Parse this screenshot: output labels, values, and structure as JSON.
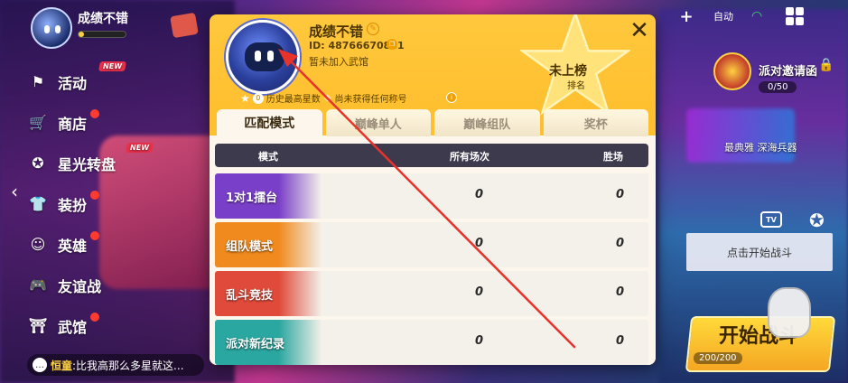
{
  "profile_top": {
    "name": "成绩不错",
    "level_progress": 0.12
  },
  "menu": {
    "items": [
      {
        "label": "活动",
        "icon": "flag-icon",
        "badge": "new"
      },
      {
        "label": "商店",
        "icon": "cart-icon",
        "badge": "dot"
      },
      {
        "label": "星光转盘",
        "icon": "star-wheel-icon",
        "badge": "new"
      },
      {
        "label": "装扮",
        "icon": "shirt-icon",
        "badge": "dot"
      },
      {
        "label": "英雄",
        "icon": "hero-icon",
        "badge": "dot"
      },
      {
        "label": "友谊战",
        "icon": "gamepad-icon",
        "badge": ""
      },
      {
        "label": "武馆",
        "icon": "guild-icon",
        "badge": "dot"
      }
    ]
  },
  "chat": {
    "name": "恒童",
    "message": ":比我高那么多星就这..."
  },
  "top_right": {
    "auto_label": "自动"
  },
  "invite": {
    "title": "派对邀请函",
    "count": "0/50"
  },
  "promo": {
    "text": "最典雅 深海兵器"
  },
  "battle": {
    "tv_label": "TV",
    "prompt": "点击开始战斗",
    "start_label": "开始战斗",
    "start_sub": "200/200"
  },
  "popup": {
    "name": "成绩不错",
    "id_text": "ID: 48766670861",
    "guild_text": "暂未加入武馆",
    "stats": {
      "best_stars": "0",
      "best_stars_label": "历史最高星数",
      "title_text": "尚未获得任何称号"
    },
    "rank": {
      "label": "未上榜",
      "sub": "排名"
    },
    "close_symbol": "✕",
    "tabs": [
      "匹配模式",
      "巅峰单人",
      "巅峰组队",
      "奖杯"
    ],
    "active_tab": 0,
    "table": {
      "headers": {
        "mode": "模式",
        "all": "所有场次",
        "win": "胜场"
      },
      "rows": [
        {
          "mode": "1对1擂台",
          "all": "0",
          "win": "0",
          "color": "#7a3fc8"
        },
        {
          "mode": "组队模式",
          "all": "0",
          "win": "0",
          "color": "#f08a1e"
        },
        {
          "mode": "乱斗竞技",
          "all": "0",
          "win": "0",
          "color": "#e04a3a"
        },
        {
          "mode": "派对新纪录",
          "all": "0",
          "win": "0",
          "color": "#2aa7a0"
        }
      ]
    }
  },
  "colors": {
    "popup_bg": "#ffc83d",
    "table_header": "#3e3a4e",
    "annotation_arrow": "#e8322a",
    "start_button": "#ffd93a"
  }
}
